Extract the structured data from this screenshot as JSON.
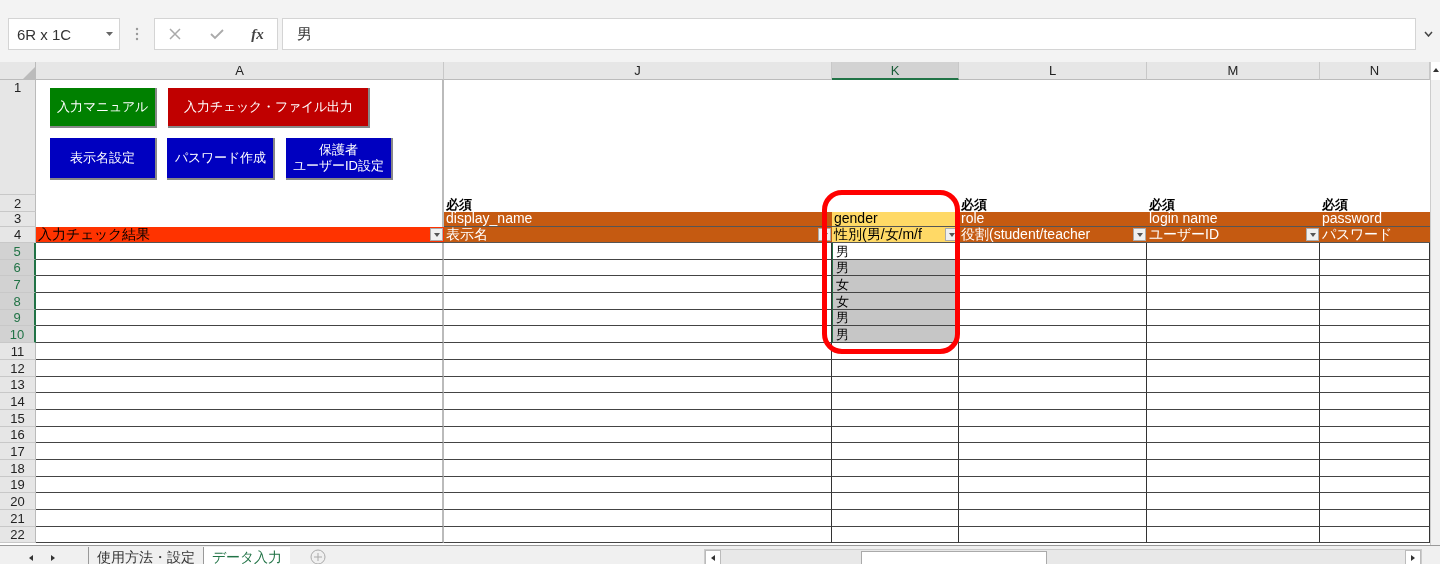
{
  "formula_bar": {
    "name_box": "6R x 1C",
    "function_label": "fx",
    "formula": "男"
  },
  "buttons": [
    {
      "label": "入力マニュアル",
      "color": "#008000"
    },
    {
      "label": "入力チェック・ファイル出力",
      "color": "#c00000"
    },
    {
      "label": "表示名設定",
      "color": "#0000c0"
    },
    {
      "label": "パスワード作成",
      "color": "#0000c0"
    },
    {
      "lines": [
        "保護者",
        "ユーザーID設定"
      ],
      "color": "#0000c0"
    }
  ],
  "columns": [
    {
      "label": "A",
      "selected": false
    },
    {
      "label": "J",
      "selected": false
    },
    {
      "label": "K",
      "selected": true
    },
    {
      "label": "L",
      "selected": false
    },
    {
      "label": "M",
      "selected": false
    },
    {
      "label": "N",
      "selected": false
    }
  ],
  "headers": [
    {
      "label": "入力チェック結果",
      "color": "#ff3300",
      "filter": true
    },
    {
      "required": "必須",
      "name": "display_name",
      "label": "表示名",
      "color": "#c55a11",
      "filter": true
    },
    {
      "name": "gender",
      "label": "性別(男/女/m/f",
      "color": "#ffd966",
      "filter": true
    },
    {
      "required": "必須",
      "name": "role",
      "label": "役割(student/teacher",
      "color": "#c55a11",
      "filter": true
    },
    {
      "required": "必須",
      "name": "login name",
      "label": "ユーザーID",
      "color": "#c55a11",
      "filter": true
    },
    {
      "required": "必須",
      "name": "password",
      "label": "パスワード",
      "color": "#c55a11",
      "filter": false
    }
  ],
  "rows": [
    {
      "number": "1",
      "selected": false
    },
    {
      "number": "2",
      "selected": false
    },
    {
      "number": "3",
      "selected": false
    },
    {
      "number": "4",
      "selected": false
    },
    {
      "number": "5",
      "selected": true
    },
    {
      "number": "6",
      "selected": true
    },
    {
      "number": "7",
      "selected": true
    },
    {
      "number": "8",
      "selected": true
    },
    {
      "number": "9",
      "selected": true
    },
    {
      "number": "10",
      "selected": true
    },
    {
      "number": "11",
      "selected": false
    },
    {
      "number": "12",
      "selected": false
    },
    {
      "number": "13",
      "selected": false
    },
    {
      "number": "14",
      "selected": false
    },
    {
      "number": "15",
      "selected": false
    },
    {
      "number": "16",
      "selected": false
    },
    {
      "number": "17",
      "selected": false
    },
    {
      "number": "18",
      "selected": false
    },
    {
      "number": "19",
      "selected": false
    },
    {
      "number": "20",
      "selected": false
    },
    {
      "number": "21",
      "selected": false
    },
    {
      "number": "22",
      "selected": false
    }
  ],
  "gender_values": [
    {
      "value": "男",
      "selected": false
    },
    {
      "value": "男",
      "selected": true
    },
    {
      "value": "女",
      "selected": true
    },
    {
      "value": "女",
      "selected": true
    },
    {
      "value": "男",
      "selected": true
    },
    {
      "value": "男",
      "selected": true
    }
  ],
  "sheet_tabs": [
    {
      "label": "使用方法・設定",
      "selected": false
    },
    {
      "label": "データ入力",
      "selected": true
    }
  ]
}
